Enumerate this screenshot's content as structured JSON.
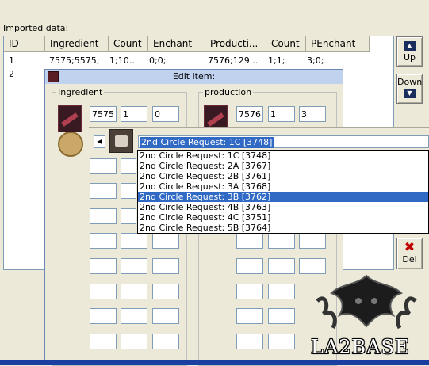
{
  "window": {
    "imported_label": "Imported data:"
  },
  "grid": {
    "columns": [
      "ID",
      "Ingredient",
      "Count",
      "Enchant",
      "Producti...",
      "Count",
      "PEnchant"
    ],
    "rows": [
      [
        "1",
        "7575;5575;",
        "1;10...",
        "0;0;",
        "7576;129...",
        "1;1;",
        "3;0;"
      ],
      [
        "2",
        "",
        "",
        "",
        "",
        "",
        ""
      ]
    ]
  },
  "side_buttons": {
    "up": "Up",
    "down": "Down",
    "del": "Del"
  },
  "dialog": {
    "title": "Edit item:",
    "ingredient_group": "Ingredient",
    "production_group": "production",
    "ingredient_row": {
      "id": "7575",
      "count": "1",
      "enchant": "0"
    },
    "production_row": {
      "id": "7576",
      "count": "1",
      "enchant": "3"
    }
  },
  "combo": {
    "selected": "2nd Circle Request: 1C  [3748]",
    "options": [
      "2nd Circle Request: 1C  [3748]",
      "2nd Circle Request: 2A  [3767]",
      "2nd Circle Request: 2B  [3761]",
      "2nd Circle Request: 3A  [3768]",
      "2nd Circle Request: 3B  [3762]",
      "2nd Circle Request: 4B  [3763]",
      "2nd Circle Request: 4C  [3751]",
      "2nd Circle Request: 5B  [3764]"
    ],
    "highlighted_index": 4
  },
  "watermark": {
    "text": "LA2BASE"
  },
  "colors": {
    "selection": "#316ac5",
    "dialog_title": "#c1d2ee",
    "window_bg": "#ece9d8"
  }
}
